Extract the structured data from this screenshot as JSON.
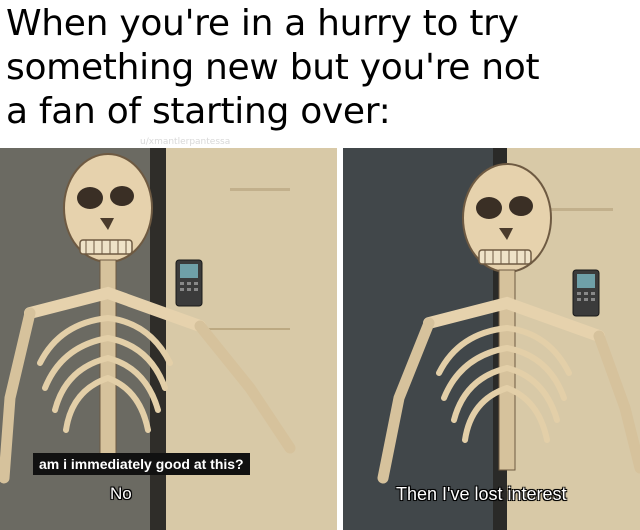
{
  "caption": {
    "lines": [
      "When you're in a hurry to try",
      "something new but you're not",
      "a fan of starting over:"
    ]
  },
  "watermark": "u/xmantlerpantessa",
  "panels": [
    {
      "subtitle_box": "am i immediately good at this?",
      "subtitle": "No"
    },
    {
      "subtitle": "Then I've lost interest"
    }
  ],
  "colors": {
    "wall": "#d9c9a6",
    "door": "#3f4244",
    "bone": "#e9d8b8",
    "bone_shadow": "#7a6248"
  }
}
